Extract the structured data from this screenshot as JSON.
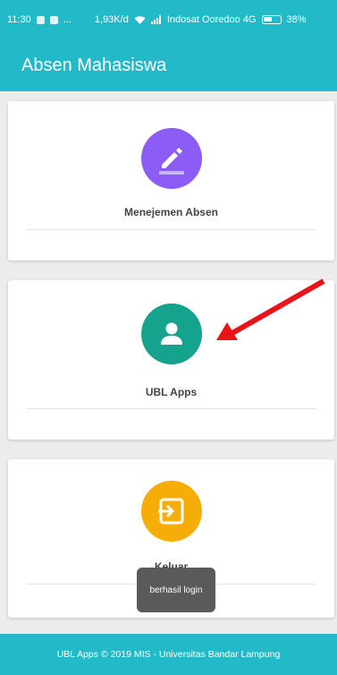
{
  "status_bar": {
    "time": "11:30",
    "dots": "...",
    "speed": "1,93K/d",
    "carrier": "Indosat Ooredoo 4G",
    "battery": "38%"
  },
  "app_bar": {
    "title": "Absen Mahasiswa"
  },
  "menu": [
    {
      "label": "Menejemen Absen",
      "icon": "pencil-icon",
      "color": "#8b5cf6"
    },
    {
      "label": "UBL Apps",
      "icon": "person-icon",
      "color": "#16a38e"
    },
    {
      "label": "Keluar",
      "icon": "exit-icon",
      "color": "#f6ad08"
    }
  ],
  "toast": {
    "text": "berhasil login"
  },
  "footer": {
    "text": "UBL Apps © 2019 MIS - Universitas Bandar Lampung"
  },
  "colors": {
    "primary": "#22b9c9",
    "annotation_arrow": "#e8141a"
  }
}
